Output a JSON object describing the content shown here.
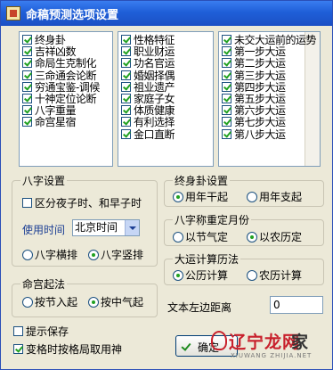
{
  "window": {
    "title": "命稿预测选项设置"
  },
  "list1": {
    "items": [
      {
        "label": "终身卦",
        "checked": true
      },
      {
        "label": "吉祥凶数",
        "checked": true
      },
      {
        "label": "命局生克制化",
        "checked": true
      },
      {
        "label": "三命通会论断",
        "checked": true
      },
      {
        "label": "穷通宝鉴-调候",
        "checked": true
      },
      {
        "label": "十神定位论断",
        "checked": true
      },
      {
        "label": "八字重量",
        "checked": true
      },
      {
        "label": "命宫星宿",
        "checked": true
      }
    ]
  },
  "list2": {
    "items": [
      {
        "label": "性格特征",
        "checked": true
      },
      {
        "label": "职业财运",
        "checked": true
      },
      {
        "label": "功名官运",
        "checked": true
      },
      {
        "label": "婚姻择偶",
        "checked": true
      },
      {
        "label": "祖业遗产",
        "checked": true
      },
      {
        "label": "家庭子女",
        "checked": true
      },
      {
        "label": "体质健康",
        "checked": true
      },
      {
        "label": "有利选择",
        "checked": true
      },
      {
        "label": "金口直断",
        "checked": true
      }
    ]
  },
  "list3": {
    "items": [
      {
        "label": "未交大运前的运势",
        "checked": true
      },
      {
        "label": "第一步大运",
        "checked": true
      },
      {
        "label": "第二步大运",
        "checked": true
      },
      {
        "label": "第三步大运",
        "checked": true
      },
      {
        "label": "第四步大运",
        "checked": true
      },
      {
        "label": "第五步大运",
        "checked": true
      },
      {
        "label": "第六步大运",
        "checked": true
      },
      {
        "label": "第七步大运",
        "checked": true
      },
      {
        "label": "第八步大运",
        "checked": true
      }
    ]
  },
  "bazi": {
    "title": "八字设置",
    "split_label": "区分夜子时、和早子时",
    "split_checked": false,
    "time_label": "使用时间",
    "time_value": "北京时间",
    "horizontal_label": "八字横排",
    "vertical_label": "八字竖排",
    "selected": "vertical"
  },
  "minggong": {
    "title": "命宫起法",
    "by_jie_label": "按节入起",
    "by_zhongqi_label": "按中气起",
    "selected": "zhongqi"
  },
  "zhongshen": {
    "title": "终身卦设置",
    "year_gan_label": "用年干起",
    "year_zhi_label": "用年支起",
    "selected": "gan"
  },
  "month": {
    "title": "八字称重定月份",
    "jieqi_label": "以节气定",
    "nongli_label": "以农历定",
    "selected": "nongli"
  },
  "dayun": {
    "title": "大运计算历法",
    "gongli_label": "公历计算",
    "nongli_label": "农历计算",
    "selected": "gongli"
  },
  "margin": {
    "label": "文本左边距离",
    "value": "0"
  },
  "bottom": {
    "save_label": "提示保存",
    "save_checked": false,
    "geju_label": "变格时按格局取用神",
    "geju_checked": true
  },
  "ok_button": {
    "label": "确定"
  },
  "watermark": {
    "text_red": "辽宁龙网",
    "text_dark": "家",
    "sub": "XIUWANG ZHIJIA.NET"
  }
}
